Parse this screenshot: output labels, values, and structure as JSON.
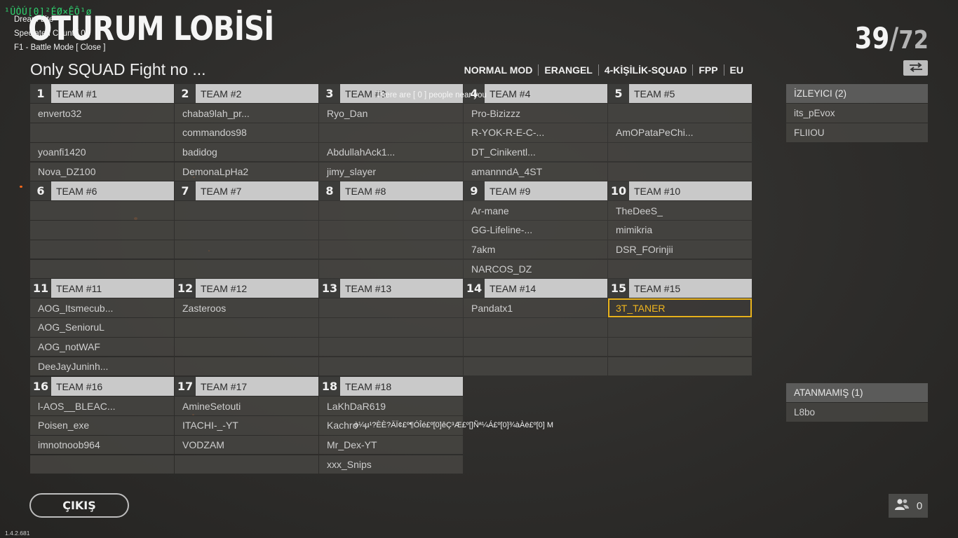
{
  "overlay": {
    "garbage_text": "¹ÛÒÚ[0]²ÉØ×ÊÔ¹ø",
    "lines": [
      "Dream Lite",
      "Spectated Count [ 0 ]",
      "F1 - Battle Mode [ Close ]"
    ]
  },
  "title": "OTURUM LOBİSİ",
  "counter": {
    "current": "39",
    "separator": "/",
    "max": "72"
  },
  "lobby_name": "Only SQUAD Fight no ...",
  "settings": [
    "NORMAL MOD",
    "ERANGEL",
    "4-KİŞİLİK-SQUAD",
    "FPP",
    "EU"
  ],
  "teams": [
    {
      "num": "1",
      "name": "TEAM #1",
      "players": [
        "enverto32",
        "",
        "yoanfi1420",
        "Nova_DZ100"
      ]
    },
    {
      "num": "2",
      "name": "TEAM #2",
      "players": [
        "chaba9lah_pr...",
        "commandos98",
        "badidog",
        "DemonaLpHa2"
      ]
    },
    {
      "num": "3",
      "name": "TEAM #3",
      "players": [
        "Ryo_Dan",
        "",
        "AbdullahAck1...",
        "jimy_slayer"
      ]
    },
    {
      "num": "4",
      "name": "TEAM #4",
      "players": [
        "Pro-Bizizzz",
        "R-YOK-R-E-C-...",
        "DT_Cinikentl...",
        "amannndA_4ST"
      ]
    },
    {
      "num": "5",
      "name": "TEAM #5",
      "players": [
        "",
        "AmOPataPeChi...",
        "",
        ""
      ]
    },
    {
      "num": "6",
      "name": "TEAM #6",
      "players": [
        "",
        "",
        "",
        ""
      ]
    },
    {
      "num": "7",
      "name": "TEAM #7",
      "players": [
        "",
        "",
        "",
        ""
      ]
    },
    {
      "num": "8",
      "name": "TEAM #8",
      "players": [
        "",
        "",
        "",
        ""
      ]
    },
    {
      "num": "9",
      "name": "TEAM #9",
      "players": [
        "Ar-mane",
        "GG-Lifeline-...",
        "7akm",
        "NARCOS_DZ"
      ]
    },
    {
      "num": "10",
      "name": "TEAM #10",
      "players": [
        "TheDeeS_",
        "mimikria",
        "DSR_FOrinjii",
        ""
      ]
    },
    {
      "num": "11",
      "name": "TEAM #11",
      "players": [
        "AOG_Itsmecub...",
        "AOG_SenioruL",
        "AOG_notWAF",
        "DeeJayJuninh..."
      ]
    },
    {
      "num": "12",
      "name": "TEAM #12",
      "players": [
        "Zasteroos",
        "",
        "",
        ""
      ]
    },
    {
      "num": "13",
      "name": "TEAM #13",
      "players": [
        "",
        "",
        "",
        ""
      ]
    },
    {
      "num": "14",
      "name": "TEAM #14",
      "players": [
        "Pandatx1",
        "",
        "",
        ""
      ]
    },
    {
      "num": "15",
      "name": "TEAM #15",
      "players": [
        "3T_TANER",
        "",
        "",
        ""
      ]
    },
    {
      "num": "16",
      "name": "TEAM #16",
      "players": [
        "l-AOS__BLEAC...",
        "Poisen_exe",
        "imnotnoob964",
        ""
      ]
    },
    {
      "num": "17",
      "name": "TEAM #17",
      "players": [
        "AmineSetouti",
        "ITACHI-_-YT",
        "VODZAM",
        ""
      ]
    },
    {
      "num": "18",
      "name": "TEAM #18",
      "players": [
        "LaKhDaR619",
        "Kachro",
        "Mr_Dex-YT",
        "xxx_Snips"
      ]
    }
  ],
  "highlighted_player": "3T_TANER",
  "spectators": {
    "title": "İZLEYICI (2)",
    "players": [
      "its_pEvox",
      "FLIIOU"
    ]
  },
  "unassigned": {
    "title": "ATANMAMIŞ (1)",
    "players": [
      "L8bo"
    ]
  },
  "near_text": "There are [ 0 ] people near you",
  "overlay_garbage2": "ò¼µ¹?ÈÈ?ÄÏ¢£º¶ÓÎé£º[0]êÇ³Æ£º[]Ñª¼Á£º[0]¾àÀë£º[0] M",
  "exit_label": "ÇIKIŞ",
  "friends_count": "0",
  "version": "1.4.2.681",
  "colors": {
    "highlight": "#e8b21c",
    "header_bg": "#c9c9c9",
    "slot_bg": "#464542"
  }
}
